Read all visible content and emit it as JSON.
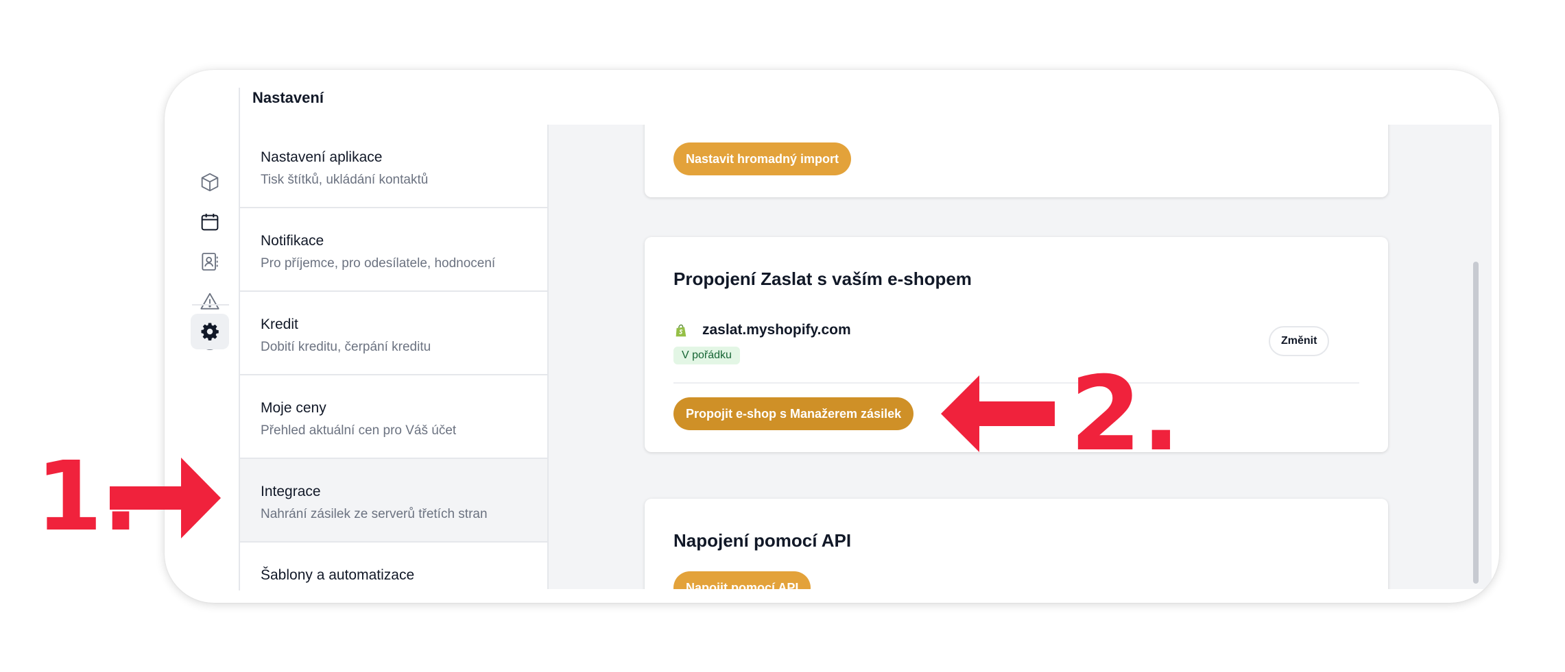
{
  "header": {
    "title": "Nastavení"
  },
  "rail": {
    "icons": [
      "package-icon",
      "calendar-icon",
      "contacts-icon",
      "warning-icon",
      "euro-icon",
      "settings-icon"
    ],
    "active": "settings-icon"
  },
  "menu": {
    "items": [
      {
        "title": "Nastavení aplikace",
        "subtitle": "Tisk štítků, ukládání kontaktů"
      },
      {
        "title": "Notifikace",
        "subtitle": "Pro příjemce, pro odesílatele, hodnocení"
      },
      {
        "title": "Kredit",
        "subtitle": "Dobití kreditu, čerpání kreditu"
      },
      {
        "title": "Moje ceny",
        "subtitle": "Přehled aktuální cen pro Váš účet"
      },
      {
        "title": "Integrace",
        "subtitle": "Nahrání zásilek ze serverů třetích stran"
      },
      {
        "title": "Šablony a automatizace",
        "subtitle": ""
      }
    ],
    "active_index": 4
  },
  "import_card": {
    "button": "Nastavit hromadný import"
  },
  "eshop_card": {
    "heading": "Propojení Zaslat s vaším e-shopem",
    "shop_name": "zaslat.myshopify.com",
    "status": "V pořádku",
    "change_button": "Změnit",
    "connect_button": "Propojit e-shop s Manažerem zásilek"
  },
  "api_card": {
    "heading": "Napojení pomocí API",
    "button": "Napojit pomocí API"
  },
  "annotations": {
    "step1": "1.",
    "step2": "2."
  },
  "colors": {
    "accent": "#e3a23a",
    "accent_dark": "#cf9027",
    "annotation": "#f0223c",
    "status_bg": "#e3f6e5",
    "status_text": "#166534",
    "shopify_green": "#95bf47"
  }
}
